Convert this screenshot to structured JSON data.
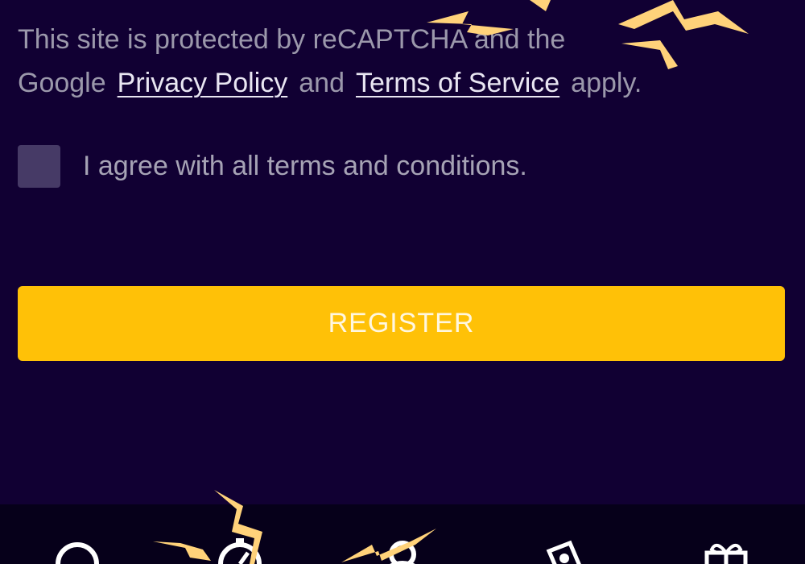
{
  "recaptcha_notice": {
    "line1": "This site is protected by reCAPTCHA and the",
    "line2_prefix": "Google",
    "privacy_link": "Privacy Policy",
    "conjunction": "and",
    "terms_link": "Terms of Service",
    "suffix": "apply."
  },
  "agreement": {
    "label": "I agree with all terms and conditions.",
    "checked": false
  },
  "register_button": {
    "label": "REGISTER"
  },
  "bottom_nav": {
    "items": [
      {
        "icon": "search-icon"
      },
      {
        "icon": "stopwatch-icon"
      },
      {
        "icon": "user-icon"
      },
      {
        "icon": "casino-chip-icon"
      },
      {
        "icon": "gift-icon"
      }
    ]
  },
  "colors": {
    "background": "#110033",
    "accent": "#ffc107",
    "checkbox": "#463a66",
    "nav_bar": "#06001a"
  }
}
